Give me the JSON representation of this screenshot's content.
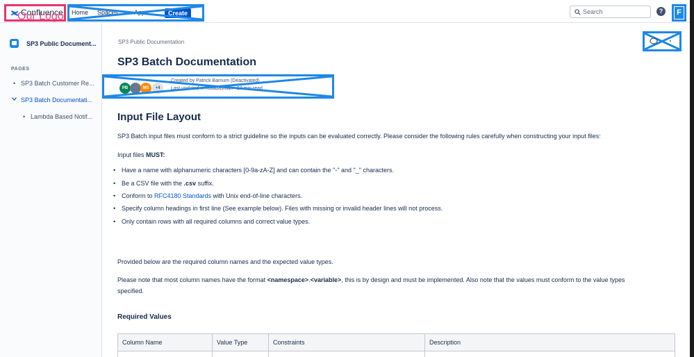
{
  "topbar": {
    "logo_text": "Confluence",
    "logo_overlay": "Our Logo",
    "nav": [
      "Home",
      "Spaces",
      "Apps"
    ],
    "create_label": "Create",
    "search_placeholder": "Search",
    "help_label": "?",
    "avatar_label": "F"
  },
  "sidebar": {
    "space_name": "SP3 Public Document...",
    "pages_label": "PAGES",
    "items": [
      {
        "label": "SP3 Batch Customer Re..."
      },
      {
        "label": "SP3 Batch Documentati..."
      },
      {
        "label": "Lambda Based Notif..."
      }
    ]
  },
  "page": {
    "breadcrumb": "SP3 Public Documentation",
    "title": "SP3 Batch Documentation",
    "byline": {
      "avatars": [
        "PB",
        "",
        "MS",
        "+4"
      ],
      "created_by": "Created by Patrick Barnum (Deactivated)",
      "updated_by": "Last updated ... Kolabashian",
      "read_time": "13 min read"
    },
    "section_heading": "Input File Layout",
    "intro": "SP3 Batch input files must conform to a strict guideline so the inputs can be evaluated correctly. Please consider the following rules carefully when constructing your input files:",
    "must_prefix": "Input files ",
    "must_bold": "MUST:",
    "rules": {
      "r1": "Have a name with alphanumeric characters [0-9a-zA-Z] and can contain the \"-\" and \"_\" characters.",
      "r2_prefix": "Be a CSV file with the ",
      "r2_bold": ".csv",
      "r2_suffix": " suffix.",
      "r3_prefix": "Conform to ",
      "r3_link": "RFC4180 Standards",
      "r3_suffix": " with Unix end-of-line characters.",
      "r4": "Specify column headings in first line (See example below). Files with missing or invalid header lines will not process.",
      "r5": "Only contain rows with all required columns and correct value types."
    },
    "provided": "Provided below are the required column names and the expected value types.",
    "note_prefix": "Please note that most column names have the format ",
    "note_bold1": "<namespace>",
    "note_dot": ".",
    "note_bold2": "<variable>",
    "note_suffix": ", this is by design and must be implemented. Also note that the values must conform to the value types",
    "note_line2": "specified.",
    "required_heading": "Required Values",
    "table_headers": [
      "Column Name",
      "Value Type",
      "Constraints",
      "Description"
    ]
  }
}
